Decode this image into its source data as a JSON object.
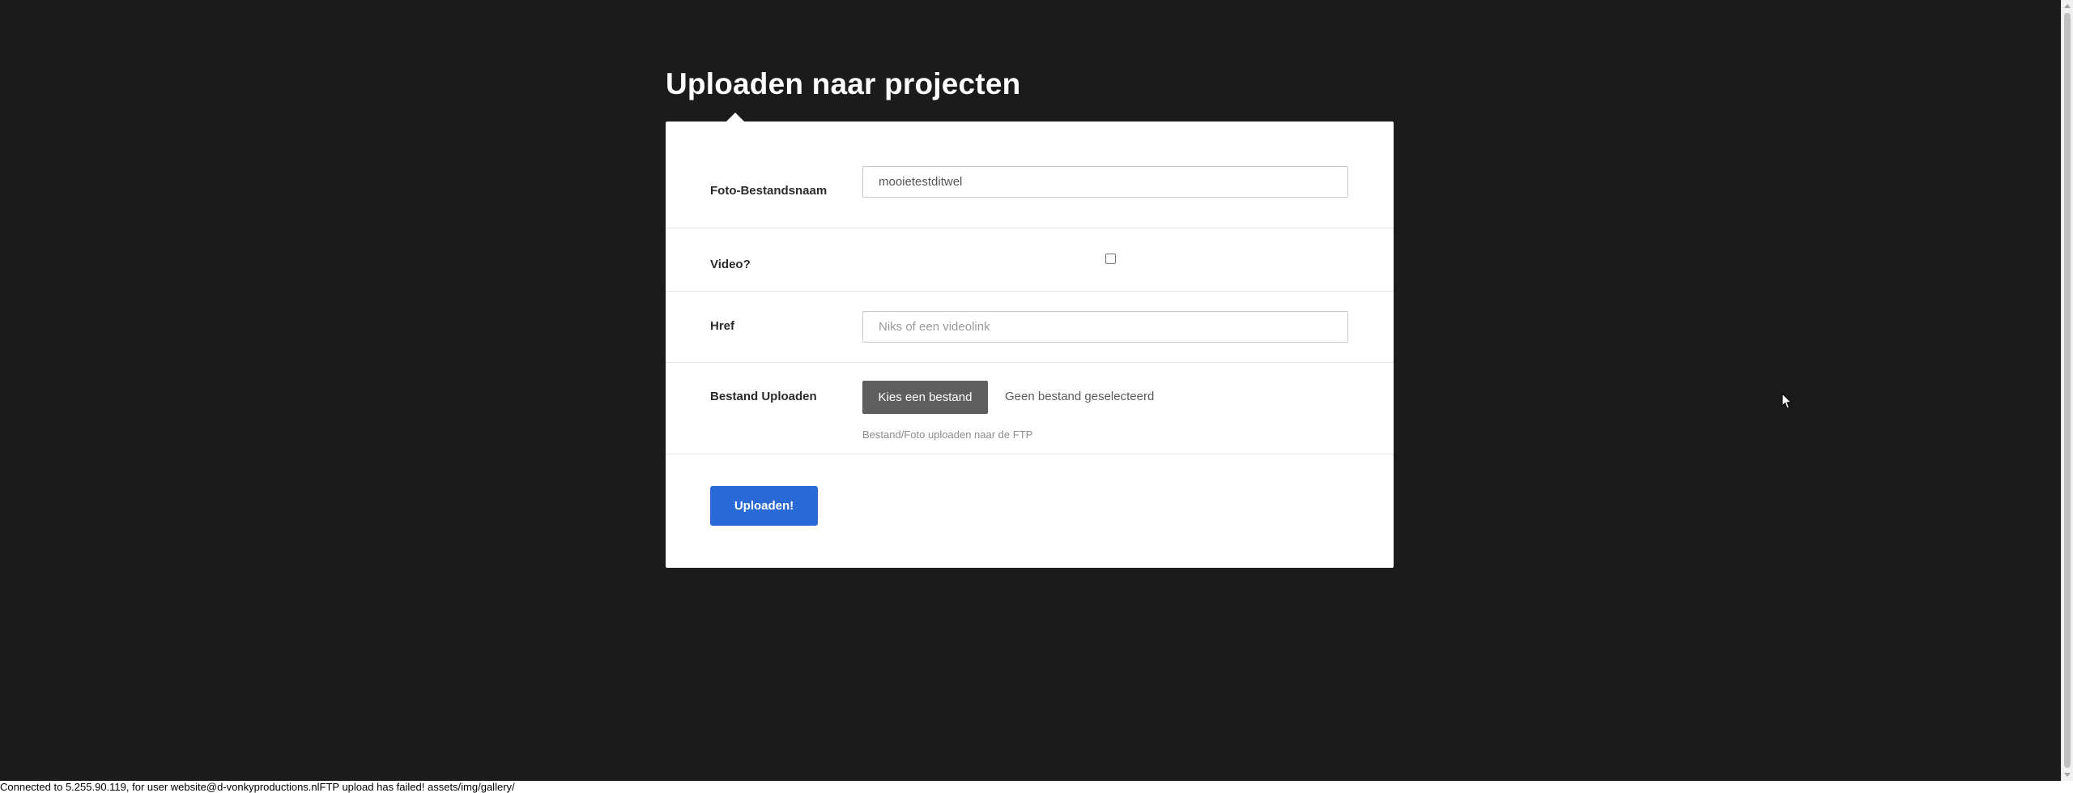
{
  "page": {
    "title": "Uploaden naar projecten"
  },
  "form": {
    "filename": {
      "label": "Foto-Bestandsnaam",
      "value": "mooietestditwel"
    },
    "video": {
      "label": "Video?",
      "checked": false
    },
    "href": {
      "label": "Href",
      "value": "",
      "placeholder": "Niks of een videolink"
    },
    "upload": {
      "label": "Bestand Uploaden",
      "button_label": "Kies een bestand",
      "status": "Geen bestand geselecteerd",
      "help": "Bestand/Foto uploaden naar de FTP"
    },
    "submit_label": "Uploaden!"
  },
  "status_bar": {
    "text": "Connected to 5.255.90.119, for user website@d-vonkyproductions.nlFTP upload has failed! assets/img/gallery/"
  },
  "colors": {
    "background": "#1b1b1b",
    "card": "#ffffff",
    "primary_button": "#2a6ad6",
    "file_button": "#5e5e5e"
  },
  "icons": {
    "cursor": "mouse-pointer-icon",
    "scroll_up": "scroll-up-arrow-icon",
    "scroll_down": "scroll-down-arrow-icon"
  }
}
